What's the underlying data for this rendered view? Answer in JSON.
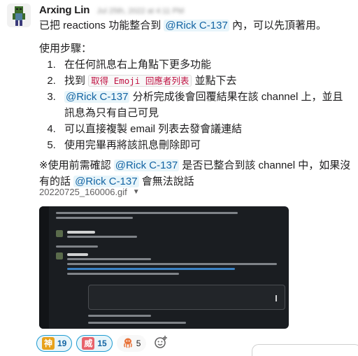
{
  "message": {
    "author": "Arxing Lin",
    "timestamp": "Jul 25th, 2022 at 4:11 PM",
    "intro": {
      "prefix": "已把 reactions 功能整合到 ",
      "mention": "@Rick C-137",
      "suffix": " 內，可以先頂著用。"
    },
    "steps_title": "使用步驟：",
    "steps": [
      {
        "text": "在任何訊息右上角點下更多功能"
      },
      {
        "prefix": "找到 ",
        "code": "取得 Emoji 回應者列表",
        "suffix": " 並點下去"
      },
      {
        "mention": "@Rick C-137",
        "suffix": " 分析完成後會回覆結果在該 channel 上，並且訊息為只有自己可見"
      },
      {
        "text": "可以直接複製 email 列表去發會議連結"
      },
      {
        "text": "使用完畢再將該訊息刪除即可"
      }
    ],
    "note": {
      "prefix": "※使用前需確認 ",
      "mention1": "@Rick C-137",
      "middle": " 是否已整合到該 channel 中，如果沒有的話 ",
      "mention2": "@Rick C-137",
      "suffix": " 會無法說話"
    },
    "file_name": "20220725_160006.gif"
  },
  "reactions": [
    {
      "emoji": "神",
      "count": "19",
      "color": "#e8a21b",
      "active": true
    },
    {
      "emoji": "威",
      "count": "15",
      "color": "#e8636b",
      "active": true
    },
    {
      "emoji": "octopus",
      "count": "5",
      "color": "#e8743b",
      "active": false
    }
  ],
  "icons": {
    "add_reaction": "add-reaction-icon",
    "dropdown": "chevron-down-icon"
  }
}
